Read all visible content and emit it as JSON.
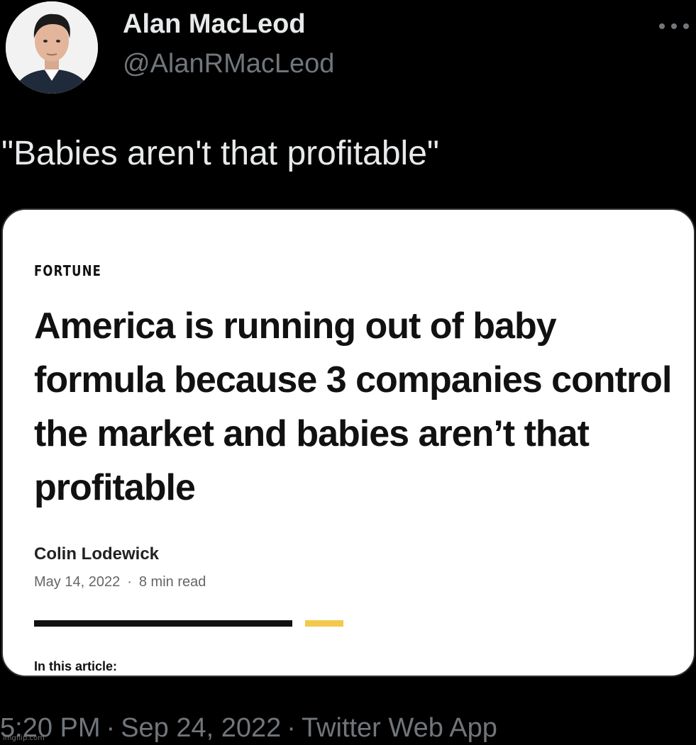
{
  "tweet": {
    "author": {
      "display_name": "Alan MacLeod",
      "handle": "@AlanRMacLeod",
      "avatar_icon": "profile-photo"
    },
    "more_icon": "more-horizontal-icon",
    "text": "\"Babies aren't that profitable\"",
    "timestamp": {
      "time": "5:20 PM",
      "date": "Sep 24, 2022",
      "client": "Twitter Web App",
      "separator": "·"
    }
  },
  "article": {
    "publication": "FORTUNE",
    "headline": "America is running out of baby formula because 3 companies control the market and babies aren’t that profitable",
    "author": "Colin Lodewick",
    "date": "May 14, 2022",
    "separator": "·",
    "read_time": "8 min read",
    "section_label": "In this article:",
    "accent_color": "#f2c94c"
  },
  "watermark": "imgflip.com",
  "colors": {
    "background": "#000000",
    "primary_text": "#e7e9ea",
    "secondary_text": "#71767b",
    "card_background": "#ffffff"
  }
}
